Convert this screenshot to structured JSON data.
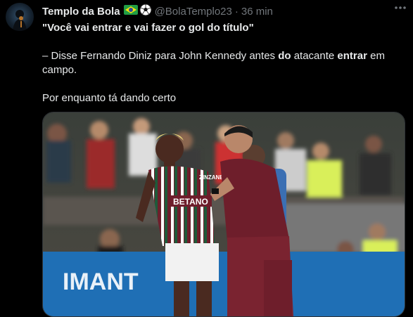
{
  "author": {
    "name": "Templo da Bola",
    "flag_emoji": "🇧🇷",
    "ball_emoji": "⚽",
    "handle": "@BolaTemplo23",
    "separator": "·",
    "time": "36 min",
    "more_icon": "ellipsis-icon"
  },
  "tweet": {
    "line1": "\"Você vai entrar e vai fazer o gol do título\"",
    "line2_a": "– Disse Fernando Diniz para John Kennedy antes ",
    "line2_b": "do",
    "line2_c": " atacante ",
    "line2_d": "entrar",
    "line2_e": " em",
    "line3": "campo.",
    "line4": "Por enquanto tá dando certo"
  },
  "media": {
    "jersey_sponsor": "BETANO",
    "jersey_brand": "ZINZANE",
    "board_text": "IMANT"
  },
  "colors": {
    "background": "#000000",
    "text": "#e7e9ea",
    "muted": "#71767b",
    "grena": "#6e1e2b",
    "green_stripe": "#1f5a3a"
  }
}
